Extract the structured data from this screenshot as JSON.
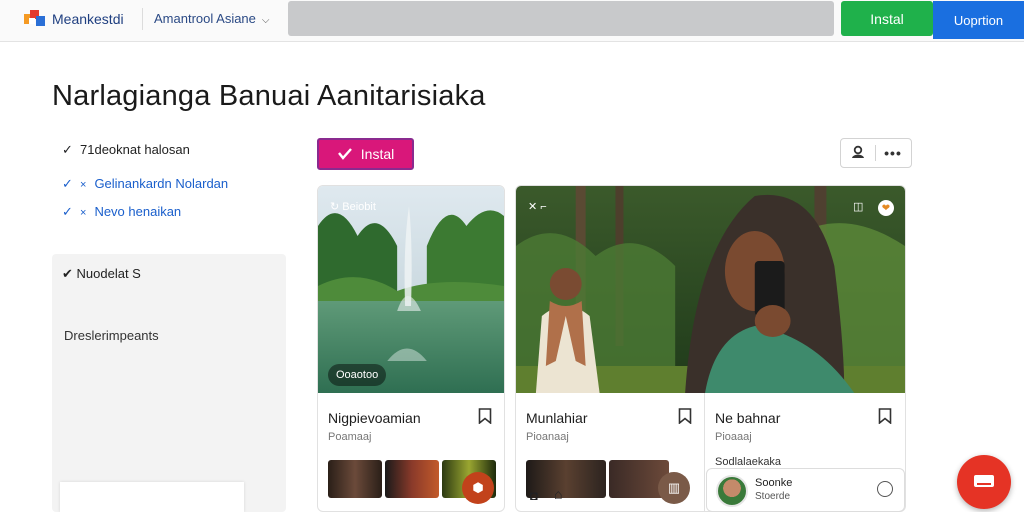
{
  "header": {
    "brand": "Meankestdi",
    "workspace": "Amantrool Asiane",
    "install_label": "Instal",
    "option_label": "Uoprtion"
  },
  "page": {
    "title": "Narlagianga Banuai Aanitarisiaka"
  },
  "checklist": [
    {
      "mark": "✓",
      "prefix": "",
      "label": "71deoknat halosan",
      "color": "#222222"
    },
    {
      "mark": "✓",
      "prefix": "×",
      "label": "Gelinankardn Nolardan",
      "color": "#1a5fcc"
    },
    {
      "mark": "✓",
      "prefix": "×",
      "label": "Nevo henaikan",
      "color": "#1a5fcc"
    }
  ],
  "panel": {
    "label": "Nuodelat S",
    "sub": "Dreslerimpeants"
  },
  "actions": {
    "install_label": "Instal",
    "icons": [
      "user-icon",
      "more-icon"
    ]
  },
  "cards": [
    {
      "overlay_label": "Beiobit",
      "chip": "Ooaotoo",
      "title": "Nigpievoamian",
      "subtitle": "Poamaaj"
    },
    {
      "overlay_label": "",
      "chip": "",
      "title": "Munlahiar",
      "subtitle": "Pioanaaj"
    },
    {
      "overlay_label": "",
      "chip": "",
      "title": "Ne bahnar",
      "subtitle": "Pioaaaj",
      "extra": "Sodlalaekaka"
    }
  ],
  "profile": {
    "name": "Soonke",
    "sub": "Stoerde"
  },
  "colors": {
    "install_green": "#1fb14b",
    "option_blue": "#1a6fe0",
    "install_pink": "#d9177a",
    "fab_red": "#e53325"
  }
}
